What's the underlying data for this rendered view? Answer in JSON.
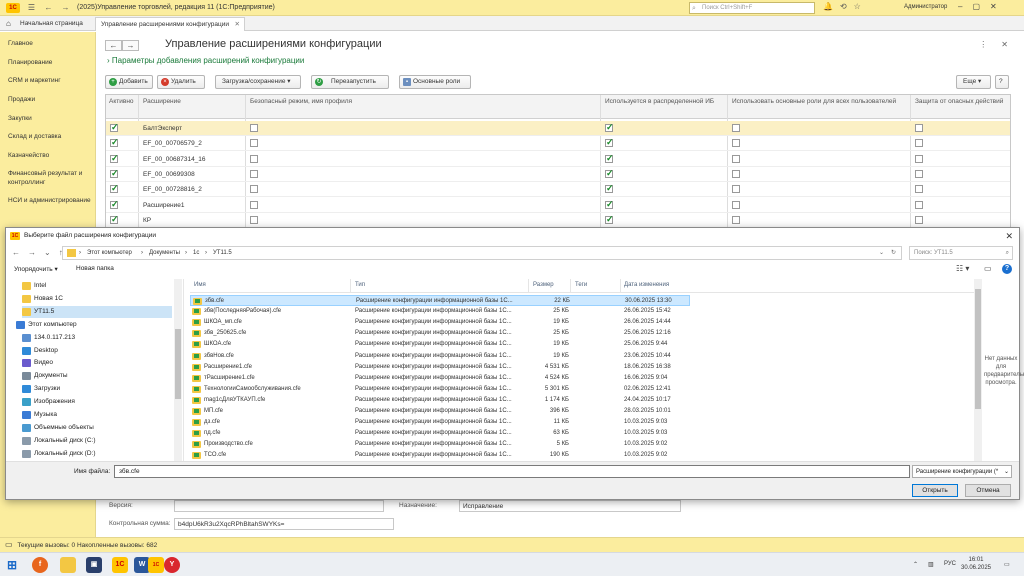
{
  "app": {
    "title": "(2025)Управление торговлей, редакция 11  (1С:Предприятие)",
    "search_placeholder": "Поиск Ctrl+Shift+F",
    "user": "Администратор"
  },
  "tabs": [
    {
      "label": "Начальная страница"
    },
    {
      "label": "Управление расширениями конфигурации"
    }
  ],
  "sidebar": {
    "items": [
      {
        "label": "Главное"
      },
      {
        "label": "Планирование"
      },
      {
        "label": "CRM и маркетинг"
      },
      {
        "label": "Продажи"
      },
      {
        "label": "Закупки"
      },
      {
        "label": "Склад и доставка"
      },
      {
        "label": "Казначейство"
      },
      {
        "label": "Финансовый результат и контроллинг"
      },
      {
        "label": "НСИ и администрирование"
      }
    ]
  },
  "form": {
    "title": "Управление расширениями конфигурации",
    "subtitle": "Параметры добавления расширений конфигурации",
    "toolbar": {
      "add": "Добавить",
      "delete": "Удалить",
      "load_save": "Загрузка/сохранение",
      "restart": "Перезапустить",
      "main_roles": "Основные роли",
      "more": "Еще"
    },
    "columns": {
      "active": "Активно",
      "extension": "Расширение",
      "safe_mode": "Безопасный режим, имя профиля",
      "used_in_distributed": "Используется в распределенной ИБ",
      "use_main_roles": "Использовать основные роли для всех пользователей",
      "protection": "Защита от опасных действий"
    },
    "rows": [
      {
        "name": "БалтЭксперт",
        "active": true,
        "safe": false,
        "distributed": true,
        "roles": false,
        "protect": false
      },
      {
        "name": "EF_00_00706579_2",
        "active": true,
        "safe": false,
        "distributed": true,
        "roles": false,
        "protect": false
      },
      {
        "name": "EF_00_00687314_16",
        "active": true,
        "safe": false,
        "distributed": true,
        "roles": false,
        "protect": false
      },
      {
        "name": "EF_00_00699308",
        "active": true,
        "safe": false,
        "distributed": true,
        "roles": false,
        "protect": false
      },
      {
        "name": "EF_00_00728816_2",
        "active": true,
        "safe": false,
        "distributed": true,
        "roles": false,
        "protect": false
      },
      {
        "name": "Расширение1",
        "active": true,
        "safe": false,
        "distributed": true,
        "roles": false,
        "protect": false
      },
      {
        "name": "КР",
        "active": true,
        "safe": false,
        "distributed": true,
        "roles": false,
        "protect": false
      }
    ],
    "version_label": "Версия:",
    "purpose_label": "Назначение:",
    "purpose_value": "Исправление",
    "checksum_label": "Контрольная сумма:",
    "checksum_value": "b4dpU6kR3u2XqcRPhBltahSWYKs="
  },
  "status": {
    "text": "Текущие вызовы: 0    Накопленные вызовы: 682"
  },
  "dialog": {
    "title": "Выберите файл расширения конфигурации",
    "breadcrumb": [
      "Этот компьютер",
      "Документы",
      "1с",
      "УТ11.5"
    ],
    "search_placeholder": "Поиск: УТ11.5",
    "organize": "Упорядочить ▾",
    "new_folder": "Новая папка",
    "tree": [
      {
        "label": "Intel",
        "type": "folder"
      },
      {
        "label": "Новая 1С",
        "type": "folder"
      },
      {
        "label": "УТ11.5",
        "type": "folder"
      },
      {
        "label": "Этот компьютер",
        "type": "pc"
      },
      {
        "label": "134.0.117.213",
        "type": "net"
      },
      {
        "label": "Desktop",
        "type": "desktop"
      },
      {
        "label": "Видео",
        "type": "video"
      },
      {
        "label": "Документы",
        "type": "docs"
      },
      {
        "label": "Загрузки",
        "type": "download"
      },
      {
        "label": "Изображения",
        "type": "images"
      },
      {
        "label": "Музыка",
        "type": "music"
      },
      {
        "label": "Объемные объекты",
        "type": "3d"
      },
      {
        "label": "Локальный диск (C:)",
        "type": "disk"
      },
      {
        "label": "Локальный диск (D:)",
        "type": "disk"
      }
    ],
    "columns": {
      "name": "Имя",
      "type": "Тип",
      "size": "Размер",
      "tags": "Теги",
      "modified": "Дата изменения"
    },
    "files": [
      {
        "name": "збв.cfe",
        "type": "Расширение конфигурации информационной базы 1С...",
        "size": "22 КБ",
        "date": "30.06.2025 13:30"
      },
      {
        "name": "збв(ПоследняяРабочая).cfe",
        "type": "Расширение конфигурации информационной базы 1С...",
        "size": "25 КБ",
        "date": "26.06.2025 15:42"
      },
      {
        "name": "ШКОА_мп.cfe",
        "type": "Расширение конфигурации информационной базы 1С...",
        "size": "19 КБ",
        "date": "26.06.2025 14:44"
      },
      {
        "name": "збв_250625.cfe",
        "type": "Расширение конфигурации информационной базы 1С...",
        "size": "25 КБ",
        "date": "25.06.2025 12:16"
      },
      {
        "name": "ШКОА.cfe",
        "type": "Расширение конфигурации информационной базы 1С...",
        "size": "19 КБ",
        "date": "25.06.2025 9:44"
      },
      {
        "name": "збвНов.cfe",
        "type": "Расширение конфигурации информационной базы 1С...",
        "size": "19 КБ",
        "date": "23.06.2025 10:44"
      },
      {
        "name": "Расширение1.cfe",
        "type": "Расширение конфигурации информационной базы 1С...",
        "size": "4 531 КБ",
        "date": "18.06.2025 16:38"
      },
      {
        "name": "тРасширение1.cfe",
        "type": "Расширение конфигурации информационной базы 1С...",
        "size": "4 524 КБ",
        "date": "16.06.2025 9:04"
      },
      {
        "name": "ТехнологииСамообслуживания.cfe",
        "type": "Расширение конфигурации информационной базы 1С...",
        "size": "5 301 КБ",
        "date": "02.06.2025 12:41"
      },
      {
        "name": "mag1сДляУТКАУП.cfe",
        "type": "Расширение конфигурации информационной базы 1С...",
        "size": "1 174 КБ",
        "date": "24.04.2025 10:17"
      },
      {
        "name": "МП.cfe",
        "type": "Расширение конфигурации информационной базы 1С...",
        "size": "396 КБ",
        "date": "28.03.2025 10:01"
      },
      {
        "name": "дз.cfe",
        "type": "Расширение конфигурации информационной базы 1С...",
        "size": "11 КБ",
        "date": "10.03.2025 9:03"
      },
      {
        "name": "пд.cfe",
        "type": "Расширение конфигурации информационной базы 1С...",
        "size": "63 КБ",
        "date": "10.03.2025 9:03"
      },
      {
        "name": "Производство.cfe",
        "type": "Расширение конфигурации информационной базы 1С...",
        "size": "5 КБ",
        "date": "10.03.2025 9:02"
      },
      {
        "name": "ТСО.cfe",
        "type": "Расширение конфигурации информационной базы 1С...",
        "size": "190 КБ",
        "date": "10.03.2025 9:02"
      }
    ],
    "preview_text": "Нет данных для предварительного просмотра.",
    "filename_label": "Имя файла:",
    "filename_value": "збв.cfe",
    "filetype_value": "Расширение конфигурации (*",
    "open_label": "Открыть",
    "cancel_label": "Отмена"
  },
  "taskbar": {
    "lang": "РУС",
    "time": "16:01",
    "date": "30.06.2025"
  },
  "colors": {
    "yellow": "#fbed9e",
    "green_check": "#1a8a2a",
    "link_green": "#1a7a3a",
    "selection": "#cce8ff"
  }
}
